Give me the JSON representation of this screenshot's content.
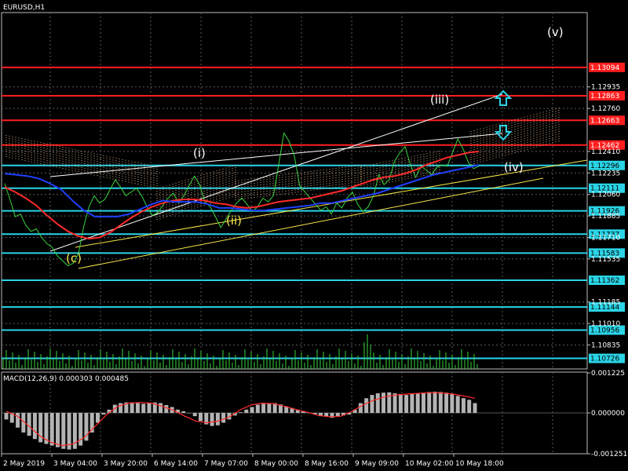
{
  "window": {
    "title": "EURUSD,H1"
  },
  "indicator": {
    "label": "MACD(12,26,9) 0.000303 0.000485"
  },
  "chart_data": [
    {
      "type": "line",
      "title": "EURUSD,H1",
      "ylim": [
        1.1064,
        1.1354
      ],
      "grid": true,
      "price_ticks": [
        "1.12935",
        "1.12760",
        "1.12410",
        "1.12235",
        "1.12060",
        "1.11885",
        "1.11710",
        "1.11535",
        "1.11185",
        "1.11010",
        "1.10835"
      ],
      "levels": [
        {
          "value": "1.13094",
          "color": "#ff1e1e"
        },
        {
          "value": "1.12863",
          "color": "#ff1e1e"
        },
        {
          "value": "1.12663",
          "color": "#ff1e1e"
        },
        {
          "value": "1.12462",
          "color": "#ff1e1e"
        },
        {
          "value": "1.12296",
          "color": "#2ad4e6"
        },
        {
          "value": "1.12111",
          "color": "#2ad4e6"
        },
        {
          "value": "1.11926",
          "color": "#2ad4e6"
        },
        {
          "value": "1.11737",
          "color": "#2ad4e6"
        },
        {
          "value": "1.11583",
          "color": "#2ad4e6"
        },
        {
          "value": "1.11362",
          "color": "#2ad4e6"
        },
        {
          "value": "1.11144",
          "color": "#2ad4e6"
        },
        {
          "value": "1.10956",
          "color": "#2ad4e6"
        },
        {
          "value": "1.10726",
          "color": "#2ad4e6"
        }
      ],
      "x_labels": [
        "2 May 2019",
        "3 May 04:00",
        "3 May 20:00",
        "6 May 14:00",
        "7 May 07:00",
        "8 May 00:00",
        "8 May 16:00",
        "9 May 09:00",
        "10 May 02:00",
        "10 May 18:00"
      ],
      "wave_labels": [
        "(c)",
        "(i)",
        "(ii)",
        "(iii)",
        "(iv)",
        "(v)"
      ],
      "series": [
        {
          "name": "price",
          "color": "#39d33f",
          "values": [
            1.1215,
            1.1202,
            1.1188,
            1.119,
            1.1181,
            1.1176,
            1.1178,
            1.1171,
            1.1166,
            1.1163,
            1.1156,
            1.1152,
            1.1148,
            1.115,
            1.1158,
            1.118,
            1.1196,
            1.1205,
            1.1199,
            1.1202,
            1.121,
            1.1218,
            1.1212,
            1.1205,
            1.1208,
            1.1211,
            1.1205,
            1.1196,
            1.1189,
            1.1191,
            1.1197,
            1.1203,
            1.1207,
            1.1199,
            1.1205,
            1.1213,
            1.1221,
            1.1214,
            1.12,
            1.1196,
            1.1188,
            1.1179,
            1.1186,
            1.1193,
            1.1199,
            1.1203,
            1.1198,
            1.1192,
            1.1196,
            1.1203,
            1.12,
            1.1205,
            1.123,
            1.1256,
            1.1249,
            1.1237,
            1.1213,
            1.1208,
            1.1203,
            1.1198,
            1.1193,
            1.1196,
            1.119,
            1.1199,
            1.1195,
            1.1203,
            1.1208,
            1.1198,
            1.1192,
            1.1196,
            1.1205,
            1.1222,
            1.1214,
            1.1218,
            1.1233,
            1.124,
            1.1245,
            1.123,
            1.122,
            1.1229,
            1.1226,
            1.1222,
            1.1228,
            1.123,
            1.1229,
            1.124,
            1.1251,
            1.1243,
            1.1232,
            1.1227,
            1.1229
          ]
        },
        {
          "name": "MA fast",
          "color": "#ff2a2a",
          "values": [
            1.1212,
            1.1208,
            1.1203,
            1.1197,
            1.1189,
            1.1182,
            1.1176,
            1.1172,
            1.117,
            1.1171,
            1.1175,
            1.1181,
            1.1187,
            1.1192,
            1.1196,
            1.1199,
            1.1201,
            1.1202,
            1.1202,
            1.1201,
            1.1199,
            1.1198,
            1.1196,
            1.1195,
            1.1196,
            1.1198,
            1.12,
            1.1201,
            1.1202,
            1.1203,
            1.1205,
            1.1207,
            1.1209,
            1.1212,
            1.1215,
            1.1218,
            1.122,
            1.1221,
            1.1223,
            1.1226,
            1.123,
            1.1233,
            1.1236,
            1.1238,
            1.124,
            1.1241
          ]
        },
        {
          "name": "MA slow",
          "color": "#2040ff",
          "values": [
            1.1223,
            1.1222,
            1.1221,
            1.1219,
            1.1215,
            1.121,
            1.1201,
            1.1193,
            1.1188,
            1.1188,
            1.1188,
            1.119,
            1.1194,
            1.1198,
            1.1201,
            1.12,
            1.12,
            1.12,
            1.1198,
            1.1195,
            1.1195,
            1.1194,
            1.1193,
            1.1193,
            1.1194,
            1.1195,
            1.1196,
            1.1197,
            1.1199,
            1.1199,
            1.1201,
            1.1203,
            1.1205,
            1.1207,
            1.121,
            1.1213,
            1.1216,
            1.1219,
            1.1222,
            1.1224,
            1.1226,
            1.1228,
            1.123
          ]
        }
      ]
    },
    {
      "type": "bar",
      "title": "MACD(12,26,9) 0.000303 0.000485",
      "ylim": [
        -0.00125,
        0.00125
      ],
      "ticks": [
        "0.001225",
        "0.000000",
        "-0.001251"
      ],
      "series": [
        {
          "name": "MACD",
          "color": "#b4b4b4",
          "values": [
            -0.0002,
            -0.0003,
            -0.00045,
            -0.0006,
            -0.0007,
            -0.0008,
            -0.0009,
            -0.00095,
            -0.001,
            -0.00105,
            -0.0011,
            -0.00112,
            -0.0011,
            -0.001,
            -0.00085,
            -0.0006,
            -0.0003,
            -5e-05,
            0.0001,
            0.00025,
            0.0003,
            0.00032,
            0.00032,
            0.0003,
            0.00028,
            0.0003,
            0.00032,
            0.0003,
            0.00024,
            0.00018,
            0.0001,
            5e-05,
            0.0,
            -0.0001,
            -0.00025,
            -0.00035,
            -0.0004,
            -0.00038,
            -0.0003,
            -0.0002,
            -8e-05,
            2e-05,
            0.0001,
            0.00018,
            0.00025,
            0.00028,
            0.0003,
            0.0003,
            0.00026,
            0.0002,
            0.00015,
            0.0001,
            5e-05,
            0.0,
            -5e-05,
            -0.0001,
            -0.00012,
            -0.00015,
            -0.00012,
            -8e-05,
            -5e-05,
            0.0001,
            0.0003,
            0.00045,
            0.00055,
            0.0006,
            0.00062,
            0.00063,
            0.0006,
            0.00058,
            0.00055,
            0.00058,
            0.0006,
            0.00062,
            0.00064,
            0.00065,
            0.00064,
            0.00062,
            0.00058,
            0.00052,
            0.00045,
            0.0004,
            0.0003
          ]
        },
        {
          "name": "Signal",
          "color": "#ff2a2a",
          "values": [
            5e-05,
            -0.0001,
            -0.0004,
            -0.0007,
            -0.0009,
            -0.001,
            -0.00095,
            -0.00075,
            -0.0004,
            -5e-05,
            0.0002,
            0.0003,
            0.00032,
            0.0003,
            0.0002,
            8e-05,
            -0.0001,
            -0.00025,
            -0.0003,
            -0.00025,
            -0.00012,
            0.0001,
            0.00025,
            0.0003,
            0.00028,
            0.0002,
            0.0001,
            2e-05,
            -8e-05,
            -0.00012,
            -0.0001,
            5e-05,
            0.00025,
            0.0004,
            0.0005,
            0.00055,
            0.00058,
            0.0006,
            0.00062,
            0.00061,
            0.00058,
            0.00052,
            0.00045
          ]
        }
      ]
    }
  ]
}
